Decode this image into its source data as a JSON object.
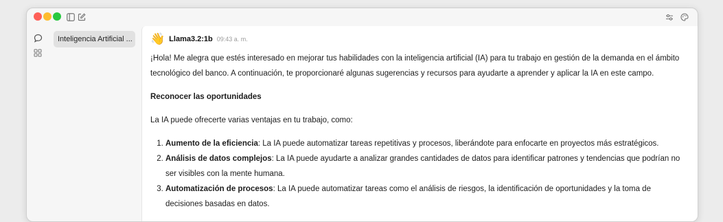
{
  "sidebar": {
    "chat_items": [
      {
        "label": "Inteligencia Artificial ..."
      }
    ]
  },
  "message": {
    "avatar": "👋",
    "sender": "Llama3.2:1b",
    "time": "09:43 a. m.",
    "intro": "¡Hola! Me alegra que estés interesado en mejorar tus habilidades con la inteligencia artificial (IA) para tu trabajo en gestión de la demanda en el ámbito tecnológico del banco. A continuación, te proporcionaré algunas sugerencias y recursos para ayudarte a aprender y aplicar la IA en este campo.",
    "heading": "Reconocer las oportunidades",
    "lead": "La IA puede ofrecerte varias ventajas en tu trabajo, como:",
    "list": [
      {
        "term": "Aumento de la eficiencia",
        "text": ": La IA puede automatizar tareas repetitivas y procesos, liberándote para enfocarte en proyectos más estratégicos."
      },
      {
        "term": "Análisis de datos complejos",
        "text": ": La IA puede ayudarte a analizar grandes cantidades de datos para identificar patrones y tendencias que podrían no ser visibles con la mente humana."
      },
      {
        "term": "Automatización de procesos",
        "text": ": La IA puede automatizar tareas como el análisis de riesgos, la identificación de oportunidades y la toma de decisiones basadas en datos."
      }
    ]
  },
  "icons": {
    "sidebar_toggle": "sidebar-toggle-icon",
    "new_chat": "compose-icon",
    "chats": "chat-bubble-icon",
    "apps": "grid-icon",
    "settings": "sliders-icon",
    "theme": "palette-icon"
  },
  "colors": {
    "close": "#fe5f57",
    "minimize": "#febc2e",
    "zoom": "#28c840"
  }
}
